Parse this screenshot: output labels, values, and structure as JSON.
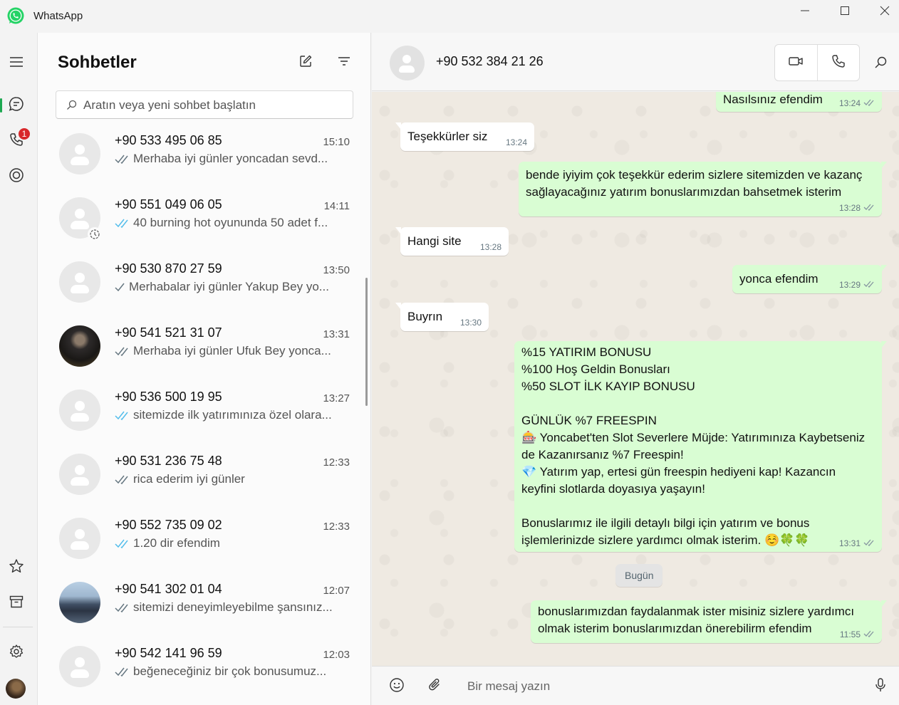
{
  "window": {
    "title": "WhatsApp",
    "icons": {
      "logo": "whatsapp-logo-icon",
      "minimize": "minimize-icon",
      "maximize": "maximize-icon",
      "close": "close-icon"
    }
  },
  "rail": {
    "icons": [
      "menu-icon",
      "chats-icon",
      "calls-icon",
      "status-icon",
      "starred-icon",
      "archive-icon",
      "settings-icon"
    ],
    "calls_badge": "1",
    "accent": "#1da851",
    "badge_color": "#d8282b"
  },
  "chat_list": {
    "title": "Sohbetler",
    "search_placeholder": "Aratın veya yeni sohbet başlatın",
    "items": [
      {
        "name": "+90 533 495 06 85",
        "time": "15:10",
        "preview": "Merhaba iyi günler yoncadan sevd...",
        "tick": "double-grey"
      },
      {
        "name": "+90 551 049 06 05",
        "time": "14:11",
        "preview": "40 burning hot oyununda 50 adet f...",
        "tick": "double-blue"
      },
      {
        "name": "+90 530 870 27 59",
        "time": "13:50",
        "preview": "Merhabalar iyi günler  Yakup Bey yo...",
        "tick": "single-grey"
      },
      {
        "name": "+90 541 521 31 07",
        "time": "13:31",
        "preview": "Merhaba iyi günler Ufuk Bey yonca...",
        "tick": "double-grey"
      },
      {
        "name": "+90 536 500 19 95",
        "time": "13:27",
        "preview": "sitemizde ilk yatırımınıza özel olara...",
        "tick": "double-blue"
      },
      {
        "name": "+90 531 236 75 48",
        "time": "12:33",
        "preview": "rica ederim iyi günler",
        "tick": "double-grey"
      },
      {
        "name": "+90 552 735 09 02",
        "time": "12:33",
        "preview": "1.20 dir efendim",
        "tick": "double-blue"
      },
      {
        "name": "+90 541 302 01 04",
        "time": "12:07",
        "preview": "sitemizi deneyimleyebilme şansınız...",
        "tick": "double-grey"
      },
      {
        "name": "+90 542 141 96 59",
        "time": "12:03",
        "preview": "beğeneceğiniz bir çok bonusumuz...",
        "tick": "double-grey"
      }
    ]
  },
  "conversation": {
    "contact": "+90 532 384 21 26",
    "date_chip": "Bugün",
    "composer_placeholder": "Bir mesaj yazın",
    "bubble_out_color": "#d9fdd3",
    "read_tick_color": "#53bdeb",
    "messages": [
      {
        "dir": "out",
        "text": "Nasılsınız efendim",
        "time": "13:24"
      },
      {
        "dir": "in",
        "text": "Teşekkürler siz",
        "time": "13:24"
      },
      {
        "dir": "out",
        "text": "bende iyiyim çok teşekkür ederim sizlere sitemizden ve kazanç\nsağlayacağınız yatırım bonuslarımızdan bahsetmek isterim",
        "time": "13:28"
      },
      {
        "dir": "in",
        "text": "Hangi site",
        "time": "13:28"
      },
      {
        "dir": "out",
        "text": "yonca efendim",
        "time": "13:29"
      },
      {
        "dir": "in",
        "text": "Buyrın",
        "time": "13:30"
      },
      {
        "dir": "out",
        "text": "%15 YATIRIM BONUSU\n%100 Hoş Geldin Bonusları\n%50 SLOT İLK KAYIP BONUSU\n\nGÜNLÜK %7 FREESPIN\n🎰 Yoncabet'ten Slot Severlere Müjde: Yatırımınıza Kaybetseniz\nde Kazanırsanız %7 Freespin!\n💎 Yatırım yap, ertesi gün freespin hediyeni kap! Kazancın\nkeyfini slotlarda doyasıya yaşayın!\n\nBonuslarımız ile ilgili detaylı bilgi için yatırım ve bonus\nişlemlerinizde sizlere yardımcı olmak isterim. ☺️🍀🍀",
        "time": "13:31"
      },
      {
        "dir": "out",
        "text": "bonuslarımızdan faydalanmak ister misiniz sizlere yardımcı\nolmak isterim bonuslarımızdan önerebilirm efendim",
        "time": "11:55"
      }
    ]
  }
}
